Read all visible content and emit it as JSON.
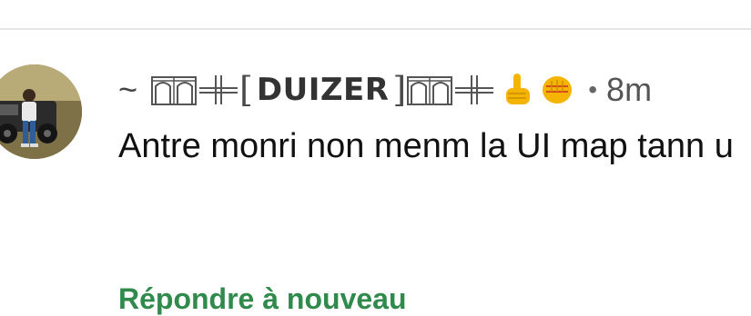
{
  "comment": {
    "author": {
      "prefix": "~",
      "bracket_open": "[",
      "name": "DUIZER",
      "bracket_close": "]",
      "avatar_icon": "user-avatar-photo"
    },
    "timestamp_separator": "•",
    "timestamp": "8m",
    "text": "Antre monri non menm la UI map tann u",
    "reply_label": "Répondre à nouveau",
    "colors": {
      "reply_link": "#2f8a4c",
      "text": "#111111",
      "meta": "#555555"
    },
    "icons": [
      "castle-icon",
      "cross-sword-icon",
      "pointing-hand-emoji",
      "raised-fist-emoji"
    ]
  }
}
